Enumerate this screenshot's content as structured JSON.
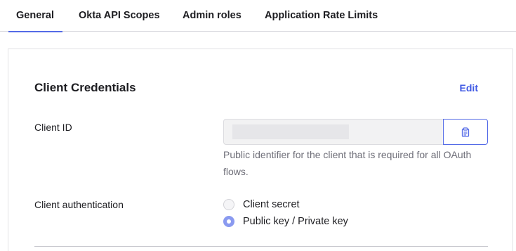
{
  "tabs": [
    {
      "label": "General",
      "active": true
    },
    {
      "label": "Okta API Scopes",
      "active": false
    },
    {
      "label": "Admin roles",
      "active": false
    },
    {
      "label": "Application Rate Limits",
      "active": false
    }
  ],
  "card": {
    "title": "Client Credentials",
    "edit_label": "Edit",
    "client_id": {
      "label": "Client ID",
      "value": "",
      "help_text": "Public identifier for the client that is required for all OAuth flows.",
      "copy_icon": "clipboard-icon"
    },
    "client_auth": {
      "label": "Client authentication",
      "options": [
        {
          "label": "Client secret",
          "selected": false
        },
        {
          "label": "Public key / Private key",
          "selected": true
        }
      ]
    }
  },
  "colors": {
    "accent": "#546be7",
    "link": "#3f59e4",
    "radio_selected": "#8a9af0",
    "help_text": "#6e6e78"
  }
}
